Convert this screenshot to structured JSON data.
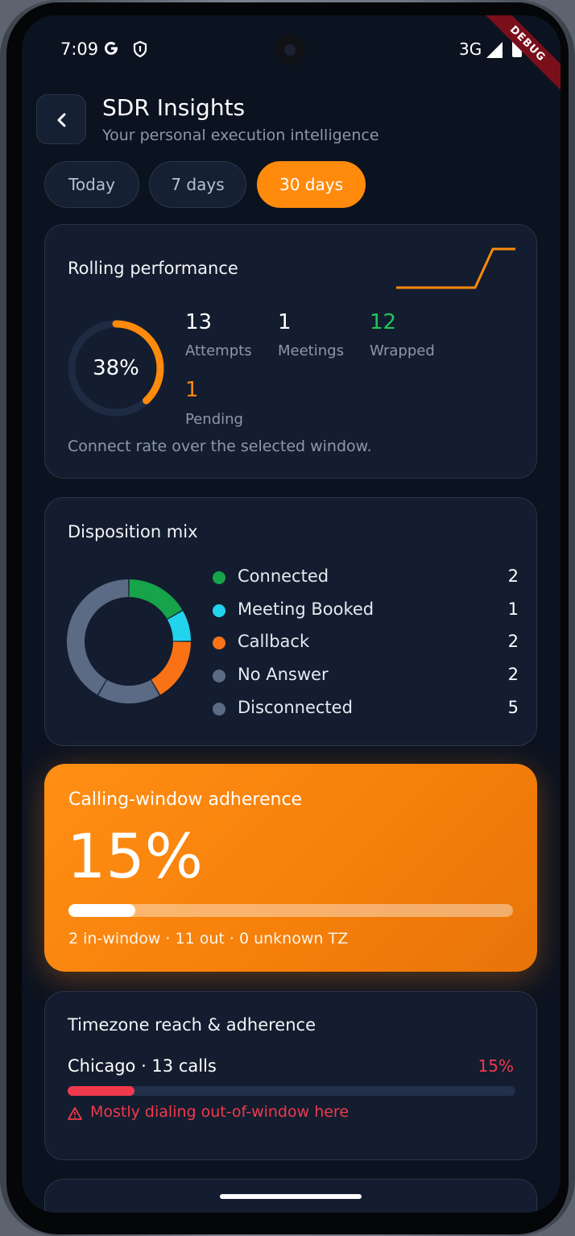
{
  "status_bar": {
    "time": "7:09",
    "network": "3G",
    "debug_banner": "DEBUG"
  },
  "header": {
    "title": "SDR Insights",
    "subtitle": "Your personal execution intelligence"
  },
  "range_tabs": [
    {
      "label": "Today",
      "selected": false
    },
    {
      "label": "7 days",
      "selected": false
    },
    {
      "label": "30 days",
      "selected": true
    }
  ],
  "rolling": {
    "title": "Rolling performance",
    "connect_rate": "38%",
    "connect_rate_value": 0.38,
    "stats": [
      {
        "value": "13",
        "label": "Attempts",
        "color": "#ffffff"
      },
      {
        "value": "1",
        "label": "Meetings",
        "color": "#ffffff"
      },
      {
        "value": "12",
        "label": "Wrapped",
        "color": "#22c55e"
      },
      {
        "value": "1",
        "label": "Pending",
        "color": "#ff8a0c"
      }
    ],
    "note": "Connect rate over the selected window."
  },
  "disposition": {
    "title": "Disposition mix",
    "items": [
      {
        "label": "Connected",
        "count": 2,
        "color": "#16a34a"
      },
      {
        "label": "Meeting Booked",
        "count": 1,
        "color": "#22d3ee"
      },
      {
        "label": "Callback",
        "count": 2,
        "color": "#f97316"
      },
      {
        "label": "No Answer",
        "count": 2,
        "color": "#5b6b85"
      },
      {
        "label": "Disconnected",
        "count": 5,
        "color": "#5b6b85"
      }
    ]
  },
  "adherence": {
    "title": "Calling-window adherence",
    "value": "15%",
    "fraction": 0.15,
    "detail": "2 in-window · 11 out · 0 unknown TZ"
  },
  "timezone": {
    "title": "Timezone reach & adherence",
    "city": "Chicago · 13 calls",
    "pct": "15%",
    "fraction": 0.15,
    "warning": "Mostly dialing out-of-window here"
  },
  "colors": {
    "accent": "#ff8a0c",
    "background": "#0b1220",
    "card": "#131d2f",
    "danger": "#f0394c",
    "success": "#22c55e"
  }
}
